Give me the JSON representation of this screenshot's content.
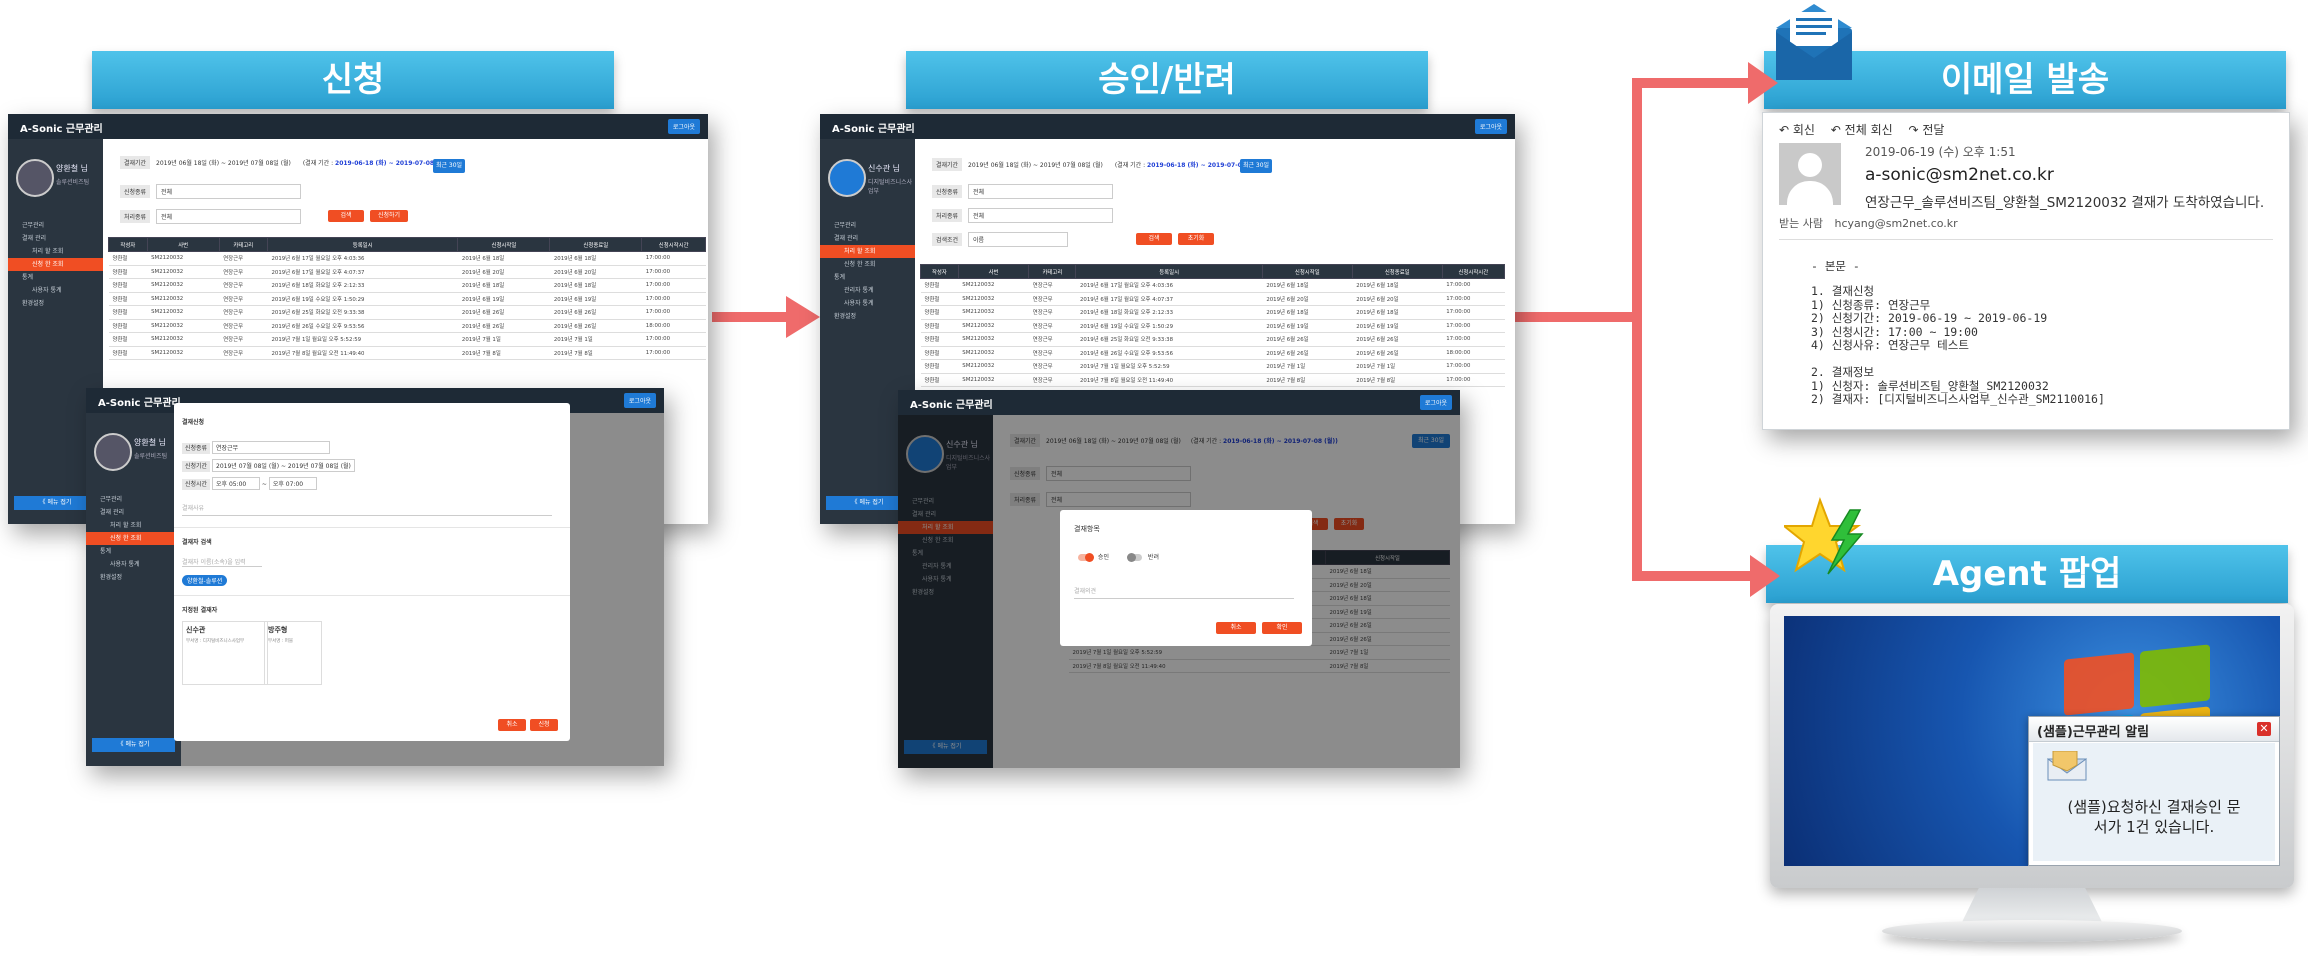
{
  "banners": {
    "request": "신청",
    "approve": "승인/반려",
    "email": "이메일 발송",
    "agent": "Agent 팝업"
  },
  "app": {
    "brand": "A-Sonic 근무관리",
    "logout": "로그아웃",
    "collapse": "《 메뉴 접기"
  },
  "left_app": {
    "user_name": "양환철 님",
    "user_dept": "솔루션비즈팀",
    "menu": [
      {
        "label": "근무관리",
        "active": false,
        "sub": false
      },
      {
        "label": "결재 관리",
        "active": false,
        "sub": false
      },
      {
        "label": "처리 할 조회",
        "active": false,
        "sub": true
      },
      {
        "label": "신청 한 조회",
        "active": true,
        "sub": true
      },
      {
        "label": "통계",
        "active": false,
        "sub": false
      },
      {
        "label": "사용자 통계",
        "active": false,
        "sub": true
      },
      {
        "label": "환경설정",
        "active": false,
        "sub": false
      }
    ],
    "filter_period_label": "결재기간",
    "filter_period_value": "2019년 06월 18일 (화) ~ 2019년 07월 08일 (월)",
    "filter_period_note": "(결재 기간 :",
    "filter_period_range": "2019-06-18 (화) ~ 2019-07-08 (월))",
    "filter_recent": "최근 30일",
    "filter_type_label": "신청종류",
    "filter_type_value": "전체",
    "filter_status_label": "처리종류",
    "filter_status_value": "전체",
    "btn_search": "검색",
    "btn_request": "신청하기",
    "columns": [
      "작성자",
      "사번",
      "카테고리",
      "등록일시",
      "신청시작일",
      "신청종료일",
      "신청시작시간"
    ],
    "rows": [
      [
        "양환철",
        "SM2120032",
        "연장근무",
        "2019년 6월 17일 월요일 오후 4:03:36",
        "2019년 6월 18일",
        "2019년 6월 18일",
        "17:00:00"
      ],
      [
        "양환철",
        "SM2120032",
        "연장근무",
        "2019년 6월 17일 월요일 오후 4:07:37",
        "2019년 6월 20일",
        "2019년 6월 20일",
        "17:00:00"
      ],
      [
        "양환철",
        "SM2120032",
        "연장근무",
        "2019년 6월 18일 화요일 오후 2:12:33",
        "2019년 6월 18일",
        "2019년 6월 18일",
        "17:00:00"
      ],
      [
        "양환철",
        "SM2120032",
        "연장근무",
        "2019년 6월 19일 수요일 오후 1:50:29",
        "2019년 6월 19일",
        "2019년 6월 19일",
        "17:00:00"
      ],
      [
        "양환철",
        "SM2120032",
        "연장근무",
        "2019년 6월 25일 화요일 오전 9:33:38",
        "2019년 6월 26일",
        "2019년 6월 26일",
        "17:00:00"
      ],
      [
        "양환철",
        "SM2120032",
        "연장근무",
        "2019년 6월 26일 수요일 오후 9:53:56",
        "2019년 6월 26일",
        "2019년 6월 26일",
        "18:00:00"
      ],
      [
        "양환철",
        "SM2120032",
        "연장근무",
        "2019년 7월 1일 월요일 오후 5:52:59",
        "2019년 7월 1일",
        "2019년 7월 1일",
        "17:00:00"
      ],
      [
        "양환철",
        "SM2120032",
        "연장근무",
        "2019년 7월 8일 월요일 오전 11:49:40",
        "2019년 7월 8일",
        "2019년 7월 8일",
        "17:00:00"
      ]
    ]
  },
  "left_popup": {
    "section1": "결재신청",
    "type_label": "신청종류",
    "type_value": "연장근무",
    "period_label": "신청기간",
    "period_value": "2019년 07월 08일 (월) ~ 2019년 07월 08일 (월)",
    "time_label": "신청시간",
    "time_start": "오후 05:00",
    "time_end": "오후 07:00",
    "reason_placeholder": "결재사유",
    "section2": "결재자 검색",
    "search_placeholder": "결재자 이름(소속)을 입력",
    "tag": "양환철-솔루션",
    "section3": "지정된 결재자",
    "approver1_name": "신수관",
    "approver1_info": "부서명 : 디지털비즈니스사업부",
    "approver2_name": "방주형",
    "approver2_info": "부서명 : 퍼블",
    "btn_cancel": "취소",
    "btn_ok": "신청"
  },
  "mid_app": {
    "user_name": "신수관 님",
    "user_dept": "디지털비즈니스사업부",
    "menu": [
      {
        "label": "근무관리",
        "active": false,
        "sub": false
      },
      {
        "label": "결재 관리",
        "active": false,
        "sub": false
      },
      {
        "label": "처리 할 조회",
        "active": true,
        "sub": true
      },
      {
        "label": "신청 한 조회",
        "active": false,
        "sub": true
      },
      {
        "label": "통계",
        "active": false,
        "sub": false
      },
      {
        "label": "관리자 통계",
        "active": false,
        "sub": true
      },
      {
        "label": "사용자 통계",
        "active": false,
        "sub": true
      },
      {
        "label": "환경설정",
        "active": false,
        "sub": false
      }
    ],
    "filter_period_label": "결재기간",
    "filter_period_value": "2019년 06월 18일 (화) ~ 2019년 07월 08일 (월)",
    "filter_period_note": "(결재 기간 :",
    "filter_period_range": "2019-06-18 (화) ~ 2019-07-08 (월))",
    "filter_recent": "최근 30일",
    "filter_type_label": "신청종류",
    "filter_type_value": "전체",
    "filter_status_label": "처리종류",
    "filter_status_value": "전체",
    "filter_cond_label": "검색조건",
    "filter_cond_value": "이름",
    "btn_search": "검색",
    "btn_reset": "초기화",
    "columns": [
      "작성자",
      "사번",
      "카테고리",
      "등록일시",
      "신청시작일",
      "신청종료일",
      "신청시작시간"
    ],
    "rows": [
      [
        "양환철",
        "SM2120032",
        "연장근무",
        "2019년 6월 17일 월요일 오후 4:03:36",
        "2019년 6월 18일",
        "2019년 6월 18일",
        "17:00:00"
      ],
      [
        "양환철",
        "SM2120032",
        "연장근무",
        "2019년 6월 17일 월요일 오후 4:07:37",
        "2019년 6월 20일",
        "2019년 6월 20일",
        "17:00:00"
      ],
      [
        "양환철",
        "SM2120032",
        "연장근무",
        "2019년 6월 18일 화요일 오후 2:12:33",
        "2019년 6월 18일",
        "2019년 6월 18일",
        "17:00:00"
      ],
      [
        "양환철",
        "SM2120032",
        "연장근무",
        "2019년 6월 19일 수요일 오후 1:50:29",
        "2019년 6월 19일",
        "2019년 6월 19일",
        "17:00:00"
      ],
      [
        "양환철",
        "SM2120032",
        "연장근무",
        "2019년 6월 25일 화요일 오전 9:33:38",
        "2019년 6월 26일",
        "2019년 6월 26일",
        "17:00:00"
      ],
      [
        "양환철",
        "SM2120032",
        "연장근무",
        "2019년 6월 26일 수요일 오후 9:53:56",
        "2019년 6월 26일",
        "2019년 6월 26일",
        "18:00:00"
      ],
      [
        "양환철",
        "SM2120032",
        "연장근무",
        "2019년 7월 1일 월요일 오후 5:52:59",
        "2019년 7월 1일",
        "2019년 7월 1일",
        "17:00:00"
      ],
      [
        "양환철",
        "SM2120032",
        "연장근무",
        "2019년 7월 8일 월요일 오전 11:49:40",
        "2019년 7월 8일",
        "2019년 7월 8일",
        "17:00:00"
      ]
    ]
  },
  "mid_popup": {
    "title": "결재항목",
    "approve": "승인",
    "reject": "반려",
    "comment_placeholder": "결재의견",
    "btn_cancel": "취소",
    "btn_ok": "확인"
  },
  "email": {
    "toolbar_reply": "회신",
    "toolbar_reply_all": "전체 회신",
    "toolbar_forward": "전달",
    "date": "2019-06-19 (수) 오후 1:51",
    "from": "a-sonic@sm2net.co.kr",
    "subject": "연장근무_솔루션비즈팀_양환철_SM2120032 결재가 도착하였습니다.",
    "to_label": "받는 사람",
    "to": "hcyang@sm2net.co.kr",
    "body_title": "- 본문 -",
    "lines": [
      "1. 결재신청",
      "1) 신청종류: 연장근무",
      "2) 신청기간: 2019-06-19 ~ 2019-06-19",
      "3) 신청시간: 17:00 ~ 19:00",
      "4) 신청사유: 연장근무 테스트",
      "",
      "2. 결재정보",
      "1) 신청자: 솔루션비즈팀_양환철_SM2120032",
      "2) 결재자: [디지털비즈니스사업부_신수관_SM2110016]"
    ]
  },
  "agent_popup": {
    "title": "(샘플)근무관리 알림",
    "message_line1": "(샘플)요청하신 결재승인 문",
    "message_line2": "서가 1건 있습니다."
  },
  "colors": {
    "banner": "#2aa0d2",
    "arrow": "#ef6b6b",
    "accent_orange": "#f04e23",
    "accent_blue": "#1f7ad6",
    "sidebar": "#2a3540"
  }
}
